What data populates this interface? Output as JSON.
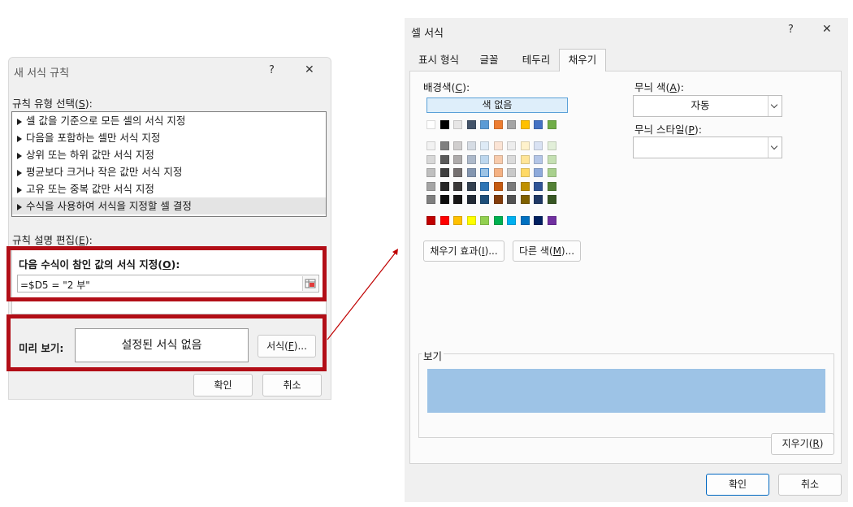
{
  "left_dialog": {
    "title": "새 서식 규칙",
    "help_label": "?",
    "close_label": "✕",
    "rule_type_label_pre": "규칙 유형 선택(",
    "rule_type_label_key": "S",
    "rule_type_label_post": "):",
    "rule_types": [
      "셀 값을 기준으로 모든 셀의 서식 지정",
      "다음을 포함하는 셀만 서식 지정",
      "상위 또는 하위 값만 서식 지정",
      "평균보다 크거나 작은 값만 서식 지정",
      "고유 또는 중복 값만 서식 지정",
      "수식을 사용하여 서식을 지정할 셀 결정"
    ],
    "edit_label_pre": "규칙 설명 편집(",
    "edit_label_key": "E",
    "edit_label_post": "):",
    "formula_label_pre": "다음 수식이 참인 값의 서식 지정(",
    "formula_label_key": "O",
    "formula_label_post": "):",
    "formula_value": "=$D5 = \"2 부\"",
    "preview_label": "미리 보기:",
    "preview_text": "설정된 서식 없음",
    "format_button_pre": "서식(",
    "format_button_key": "F",
    "format_button_post": ")...",
    "ok_label": "확인",
    "cancel_label": "취소"
  },
  "right_dialog": {
    "title": "셀 서식",
    "help_label": "?",
    "close_label": "✕",
    "tabs": [
      "표시 형식",
      "글꼴",
      "테두리",
      "채우기"
    ],
    "active_tab": "채우기",
    "bg_color_label_pre": "배경색(",
    "bg_color_label_key": "C",
    "bg_color_label_post": "):",
    "no_color_label": "색 없음",
    "theme_row1": [
      "#ffffff",
      "#000000",
      "#e7e6e6",
      "#44546a",
      "#5b9bd5",
      "#ed7d31",
      "#a5a5a5",
      "#ffc000",
      "#4472c4",
      "#70ad47"
    ],
    "theme_shades": [
      [
        "#f2f2f2",
        "#7f7f7f",
        "#d0cece",
        "#d6dce4",
        "#deebf6",
        "#fbe4d5",
        "#ededed",
        "#fff2cc",
        "#d9e2f3",
        "#e2efd9"
      ],
      [
        "#d8d8d8",
        "#595959",
        "#aeabab",
        "#adb9ca",
        "#bdd7ee",
        "#f7cbac",
        "#dbdbdb",
        "#ffe598",
        "#b4c6e7",
        "#c5e0b3"
      ],
      [
        "#bfbfbf",
        "#3f3f3f",
        "#757070",
        "#8496b0",
        "#9cc3e5",
        "#f4b183",
        "#c9c9c9",
        "#ffd965",
        "#8eaadb",
        "#a8d08d"
      ],
      [
        "#a5a5a5",
        "#262626",
        "#3a3838",
        "#323f4f",
        "#2e75b5",
        "#c55a11",
        "#7b7b7b",
        "#bf9000",
        "#2f5496",
        "#538135"
      ],
      [
        "#7f7f7f",
        "#0c0c0c",
        "#171616",
        "#222a35",
        "#1e4e79",
        "#833c0b",
        "#525252",
        "#7f6000",
        "#1f3864",
        "#375623"
      ]
    ],
    "standard_colors": [
      "#c00000",
      "#ff0000",
      "#ffc000",
      "#ffff00",
      "#92d050",
      "#00b050",
      "#00b0f0",
      "#0070c0",
      "#002060",
      "#7030a0"
    ],
    "fill_effects_pre": "채우기 효과(",
    "fill_effects_key": "I",
    "fill_effects_post": ")...",
    "more_colors_pre": "다른 색(",
    "more_colors_key": "M",
    "more_colors_post": ")...",
    "pattern_color_label_pre": "무늬 색(",
    "pattern_color_label_key": "A",
    "pattern_color_label_post": "):",
    "pattern_color_value": "자동",
    "pattern_style_label_pre": "무늬 스타일(",
    "pattern_style_label_key": "P",
    "pattern_style_label_post": "):",
    "pattern_style_value": "",
    "sample_label": "보기",
    "sample_color": "#9dc3e6",
    "selected_color": "#9cc3e5",
    "clear_pre": "지우기(",
    "clear_key": "R",
    "clear_post": ")",
    "ok_label": "확인",
    "cancel_label": "취소"
  },
  "colors": {
    "highlight_red": "#b20e17",
    "arrow_red": "#c00000",
    "dialog_bg": "#f0f0f0",
    "accent_blue": "#0067c0"
  }
}
